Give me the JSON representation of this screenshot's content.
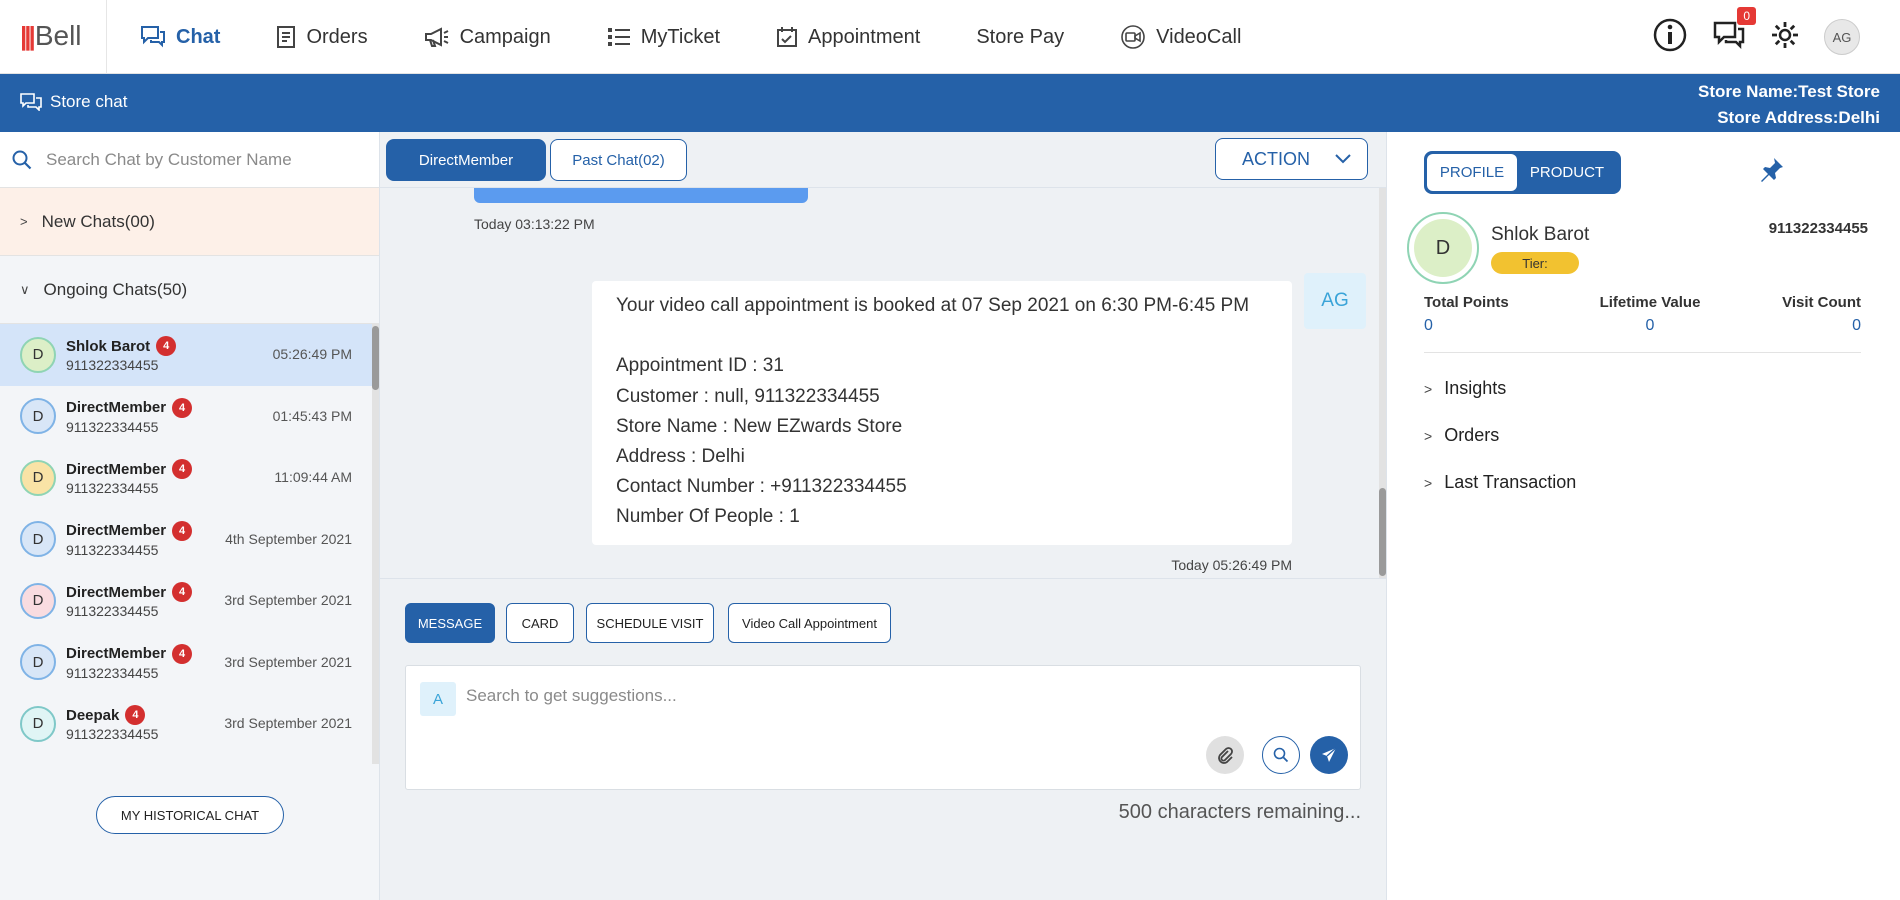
{
  "app": {
    "logo": "Bell"
  },
  "nav": {
    "items": [
      {
        "label": "Chat",
        "icon": "chat-icon",
        "active": true
      },
      {
        "label": "Orders",
        "icon": "orders-icon"
      },
      {
        "label": "Campaign",
        "icon": "megaphone-icon"
      },
      {
        "label": "MyTicket",
        "icon": "list-icon"
      },
      {
        "label": "Appointment",
        "icon": "calendar-icon"
      },
      {
        "label": "Store Pay",
        "icon": ""
      },
      {
        "label": "VideoCall",
        "icon": "video-icon"
      }
    ],
    "notification_count": "0",
    "user_initials": "AG"
  },
  "bar": {
    "title": "Store chat",
    "store_name": "Store Name:Test Store",
    "store_address": "Store Address:Delhi"
  },
  "left": {
    "search_placeholder": "Search Chat by Customer Name",
    "new_chats": "New Chats(00)",
    "ongoing_chats": "Ongoing Chats(50)",
    "chats": [
      {
        "initial": "D",
        "name": "Shlok Barot",
        "phone": "911322334455",
        "time": "05:26:49 PM",
        "unread": "4",
        "bg": "#dcefc7",
        "border": "#8fd4b4",
        "active": true
      },
      {
        "initial": "D",
        "name": "DirectMember",
        "phone": "911322334455",
        "time": "01:45:43 PM",
        "unread": "4",
        "bg": "#d8e6f7",
        "border": "#7fb3e6"
      },
      {
        "initial": "D",
        "name": "DirectMember",
        "phone": "911322334455",
        "time": "11:09:44 AM",
        "unread": "4",
        "bg": "#f9e3a6",
        "border": "#8fd4b4"
      },
      {
        "initial": "D",
        "name": "DirectMember",
        "phone": "911322334455",
        "time": "4th September 2021",
        "unread": "4",
        "bg": "#d8e6f7",
        "border": "#7fb3e6"
      },
      {
        "initial": "D",
        "name": "DirectMember",
        "phone": "911322334455",
        "time": "3rd September 2021",
        "unread": "4",
        "bg": "#f9dce0",
        "border": "#7fb3e6"
      },
      {
        "initial": "D",
        "name": "DirectMember",
        "phone": "911322334455",
        "time": "3rd September 2021",
        "unread": "4",
        "bg": "#d8e6f7",
        "border": "#7fb3e6"
      },
      {
        "initial": "D",
        "name": "Deepak",
        "phone": "911322334455",
        "time": "3rd September 2021",
        "unread": "4",
        "bg": "#e0f5f5",
        "border": "#7fc8c8"
      }
    ],
    "history_button": "MY HISTORICAL CHAT"
  },
  "middle": {
    "tab_direct": "DirectMember",
    "tab_past": "Past Chat(02)",
    "action_label": "ACTION",
    "prev_time": "Today 03:13:22 PM",
    "message_lines": [
      "Your video call appointment is booked at 07 Sep 2021 on 6:30 PM-6:45 PM",
      "",
      "Appointment ID : 31",
      "Customer : null, 911322334455",
      "Store Name : New EZwards Store",
      "Address : Delhi",
      "Contact Number : +911322334455",
      "Number Of People : 1"
    ],
    "message_avatar": "AG",
    "message_time": "Today 05:26:49 PM",
    "composer_tabs": [
      "MESSAGE",
      "CARD",
      "SCHEDULE VISIT",
      "Video Call Appointment"
    ],
    "composer_prefix": "A",
    "composer_placeholder": "Search to get suggestions...",
    "chars_remaining": "500 characters remaining..."
  },
  "right": {
    "tab_profile": "PROFILE",
    "tab_product": "PRODUCT",
    "avatar_initial": "D",
    "name": "Shlok Barot",
    "tier": "Tier:",
    "phone": "911322334455",
    "stats": [
      {
        "label": "Total Points",
        "value": "0"
      },
      {
        "label": "Lifetime Value",
        "value": "0"
      },
      {
        "label": "Visit Count",
        "value": "0"
      }
    ],
    "sections": [
      "Insights",
      "Orders",
      "Last Transaction"
    ]
  },
  "colors": {
    "primary": "#2561a8",
    "badge": "#d32f2f",
    "tier": "#f2c230"
  }
}
